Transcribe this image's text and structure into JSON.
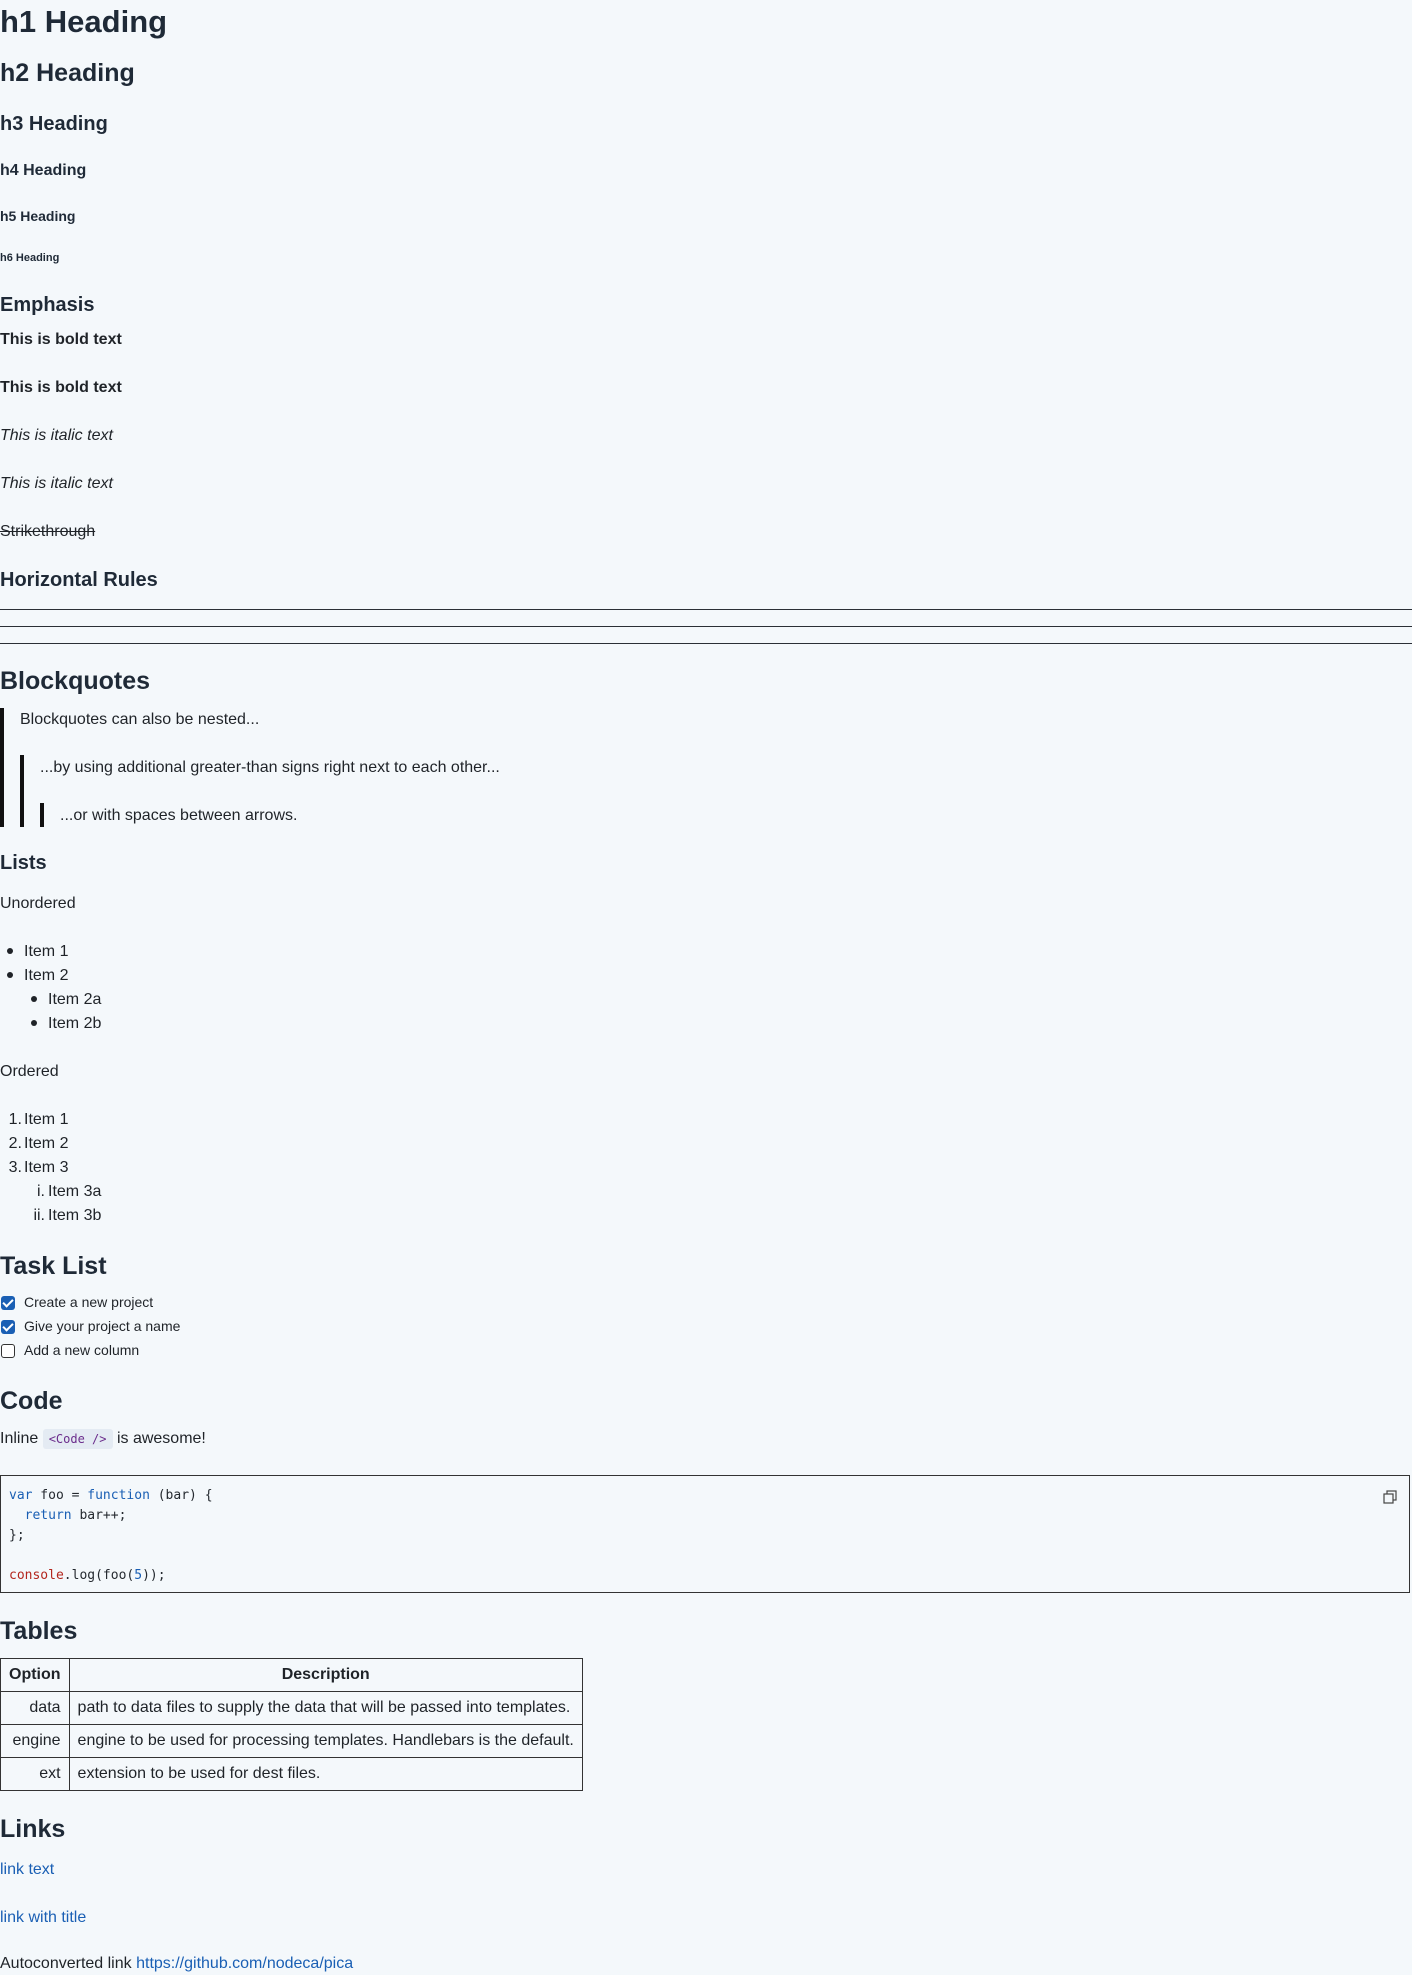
{
  "headings": {
    "h1": "h1 Heading",
    "h2": "h2 Heading",
    "h3": "h3 Heading",
    "h4": "h4 Heading",
    "h5": "h5 Heading",
    "h6": "h6 Heading"
  },
  "emphasis": {
    "title": "Emphasis",
    "bold1": "This is bold text",
    "bold2": "This is bold text",
    "italic1": "This is italic text",
    "italic2": "This is italic text",
    "strike": "Strikethrough"
  },
  "rules": {
    "title": "Horizontal Rules"
  },
  "blockquotes": {
    "title": "Blockquotes",
    "level1": "Blockquotes can also be nested...",
    "level2": "...by using additional greater-than signs right next to each other...",
    "level3": "...or with spaces between arrows."
  },
  "lists": {
    "title": "Lists",
    "unordered_label": "Unordered",
    "unordered": [
      "Item 1",
      "Item 2",
      "Item 2a",
      "Item 2b"
    ],
    "ordered_label": "Ordered",
    "ordered": [
      "Item 1",
      "Item 2",
      "Item 3"
    ],
    "ordered_markers": [
      "1.",
      "2.",
      "3."
    ],
    "ordered_sub": [
      "Item 3a",
      "Item 3b"
    ],
    "ordered_sub_markers": [
      "i.",
      "ii."
    ]
  },
  "tasks": {
    "title": "Task List",
    "items": [
      {
        "label": "Create a new project",
        "checked": true
      },
      {
        "label": "Give your project a name",
        "checked": true
      },
      {
        "label": "Add a new column",
        "checked": false
      }
    ]
  },
  "code": {
    "title": "Code",
    "inline_prefix": "Inline",
    "inline_code": "<Code />",
    "inline_suffix": "is awesome!",
    "copy_icon": "copy-icon",
    "tokens": {
      "l1_var": "var",
      "l1_mid": " foo = ",
      "l1_fn": "function",
      "l1_end": " (bar) {",
      "l2_pre": "  ",
      "l2_ret": "return",
      "l2_end": " bar++;",
      "l3": "};",
      "l5_console": "console",
      "l5_mid": ".log(foo(",
      "l5_num": "5",
      "l5_end": "));"
    }
  },
  "tables": {
    "title": "Tables",
    "headers": [
      "Option",
      "Description"
    ],
    "rows": [
      [
        "data",
        "path to data files to supply the data that will be passed into templates."
      ],
      [
        "engine",
        "engine to be used for processing templates. Handlebars is the default."
      ],
      [
        "ext",
        "extension to be used for dest files."
      ]
    ]
  },
  "links": {
    "title": "Links",
    "link1": "link text",
    "link2": "link with title",
    "auto_prefix": "Autoconverted link",
    "auto_url": "https://github.com/nodeca/pica"
  },
  "colors": {
    "background": "#f4f8fb",
    "link": "#1a5fb4",
    "keyword": "#1a5fb4",
    "object": "#b3261e",
    "inline_code": "#6b2d8c"
  }
}
